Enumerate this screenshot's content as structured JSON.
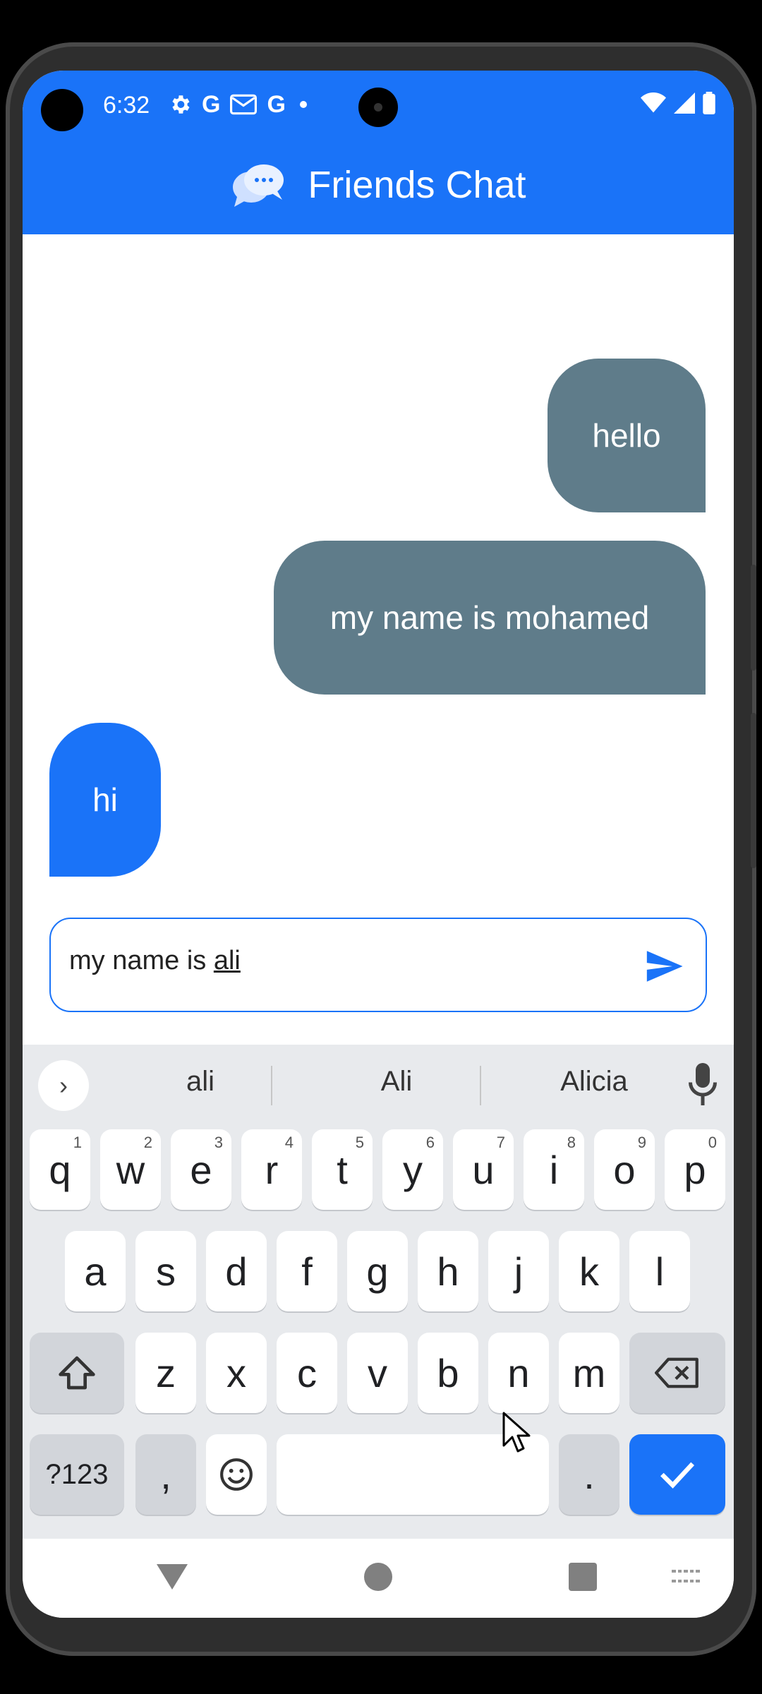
{
  "status_bar": {
    "time": "6:32",
    "left_icons": [
      "gear-icon",
      "google-g-icon",
      "gmail-icon",
      "google-g-icon",
      "dot-icon"
    ],
    "right_icons": [
      "wifi-icon",
      "signal-icon",
      "battery-icon"
    ]
  },
  "app": {
    "title": "Friends Chat",
    "icon": "chat-bubbles-icon",
    "header_color": "#1a73f8"
  },
  "messages": [
    {
      "side": "sent",
      "text": "hello"
    },
    {
      "side": "sent",
      "text": "my name is mohamed"
    },
    {
      "side": "received",
      "text": "hi"
    }
  ],
  "colors": {
    "sent_bubble": "#5f7c8a",
    "received_bubble": "#1a73f8",
    "accent": "#1a73f8"
  },
  "composer": {
    "text_prefix": "my name is ",
    "text_underlined": "ali",
    "send_icon": "send-icon"
  },
  "keyboard": {
    "suggestions": [
      "ali",
      "Ali",
      "Alicia"
    ],
    "row1": [
      {
        "key": "q",
        "hint": "1"
      },
      {
        "key": "w",
        "hint": "2"
      },
      {
        "key": "e",
        "hint": "3"
      },
      {
        "key": "r",
        "hint": "4"
      },
      {
        "key": "t",
        "hint": "5"
      },
      {
        "key": "y",
        "hint": "6"
      },
      {
        "key": "u",
        "hint": "7"
      },
      {
        "key": "i",
        "hint": "8"
      },
      {
        "key": "o",
        "hint": "9"
      },
      {
        "key": "p",
        "hint": "0"
      }
    ],
    "row2": [
      "a",
      "s",
      "d",
      "f",
      "g",
      "h",
      "j",
      "k",
      "l"
    ],
    "row3": [
      "z",
      "x",
      "c",
      "v",
      "b",
      "n",
      "m"
    ],
    "symbols_label": "?123",
    "comma": ",",
    "period": "."
  }
}
